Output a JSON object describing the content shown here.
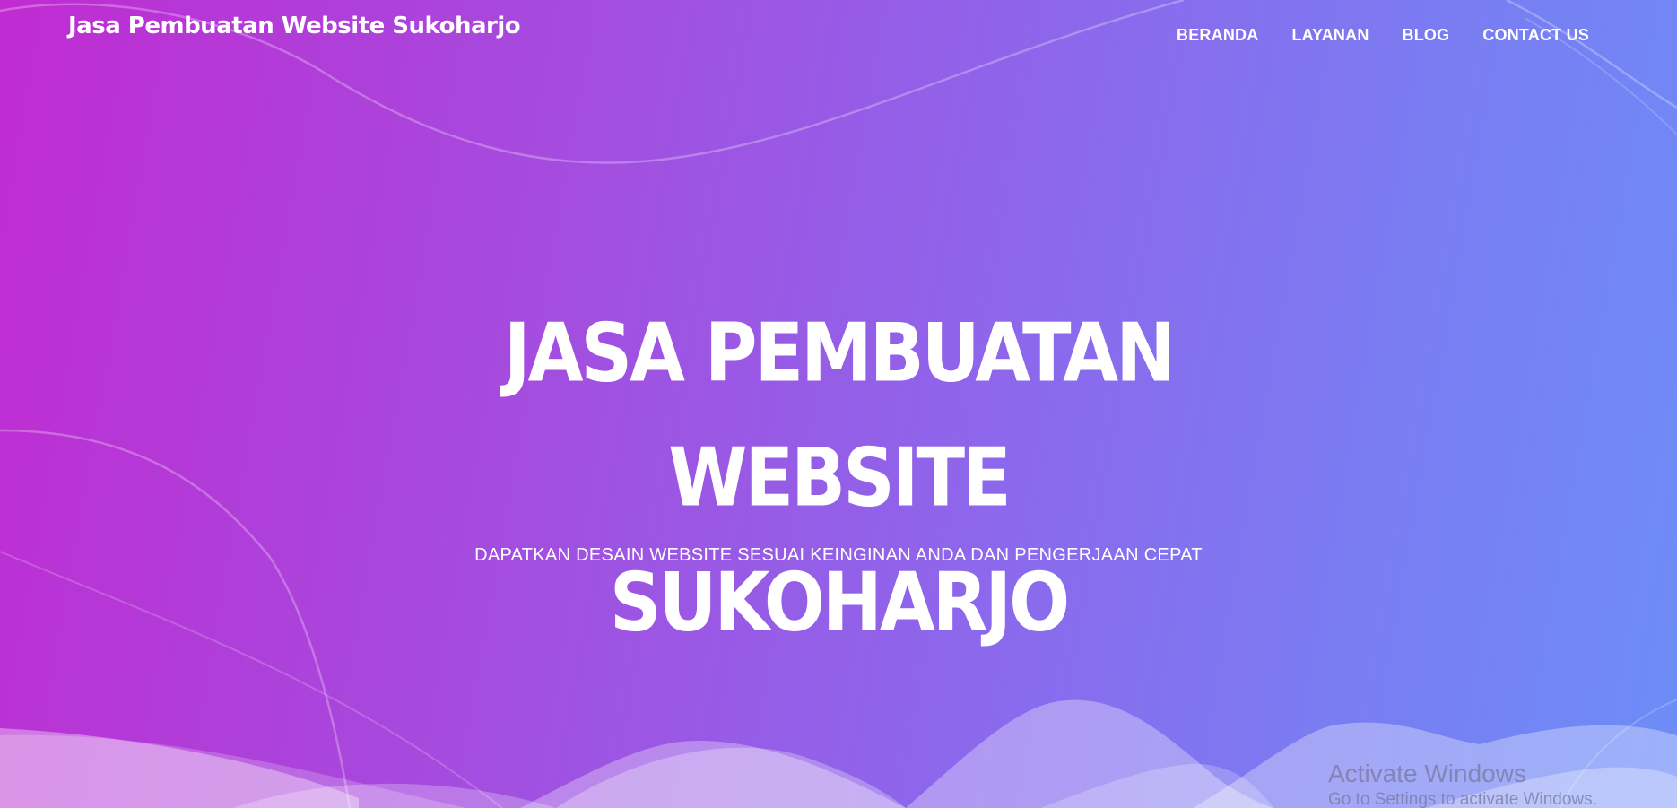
{
  "brand": {
    "title": "Jasa Pembuatan Website Sukoharjo"
  },
  "nav": {
    "items": [
      {
        "label": "BERANDA"
      },
      {
        "label": "LAYANAN"
      },
      {
        "label": "BLOG"
      },
      {
        "label": "CONTACT US"
      }
    ]
  },
  "hero": {
    "title_line1": "JASA PEMBUATAN WEBSITE",
    "title_line2": "SUKOHARJO",
    "subtitle": "DAPATKAN DESAIN WEBSITE SESUAI KEINGINAN ANDA DAN PENGERJAAN CEPAT"
  },
  "watermark": {
    "title": "Activate Windows",
    "subtitle": "Go to Settings to activate Windows."
  },
  "colors": {
    "gradient_start": "#c02bd2",
    "gradient_end": "#6d8df7",
    "text": "#ffffff"
  }
}
